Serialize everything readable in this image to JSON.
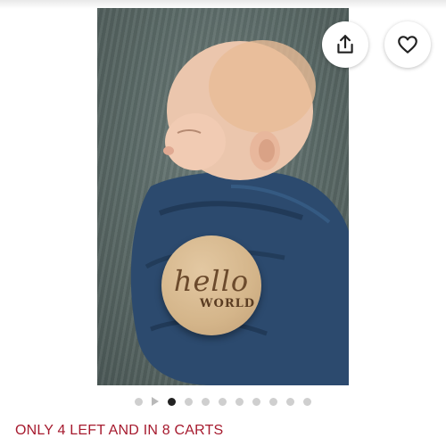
{
  "product_image": {
    "alt_subject": "newborn-swaddled-with-sign",
    "sign_script": "hello",
    "sign_word": "WORLD"
  },
  "actions": {
    "share_icon": "share-icon",
    "favorite_icon": "heart-icon"
  },
  "carousel": {
    "has_video": true,
    "total_images": 10,
    "active_index": 0
  },
  "stock_notice": "ONLY 4 LEFT AND IN 8 CARTS",
  "colors": {
    "stock_notice": "#a61a2e",
    "dot_active": "#222222",
    "dot_inactive": "#cfcfcf",
    "blanket": "#2c4a6e",
    "background_fabric": "#5a6966"
  }
}
